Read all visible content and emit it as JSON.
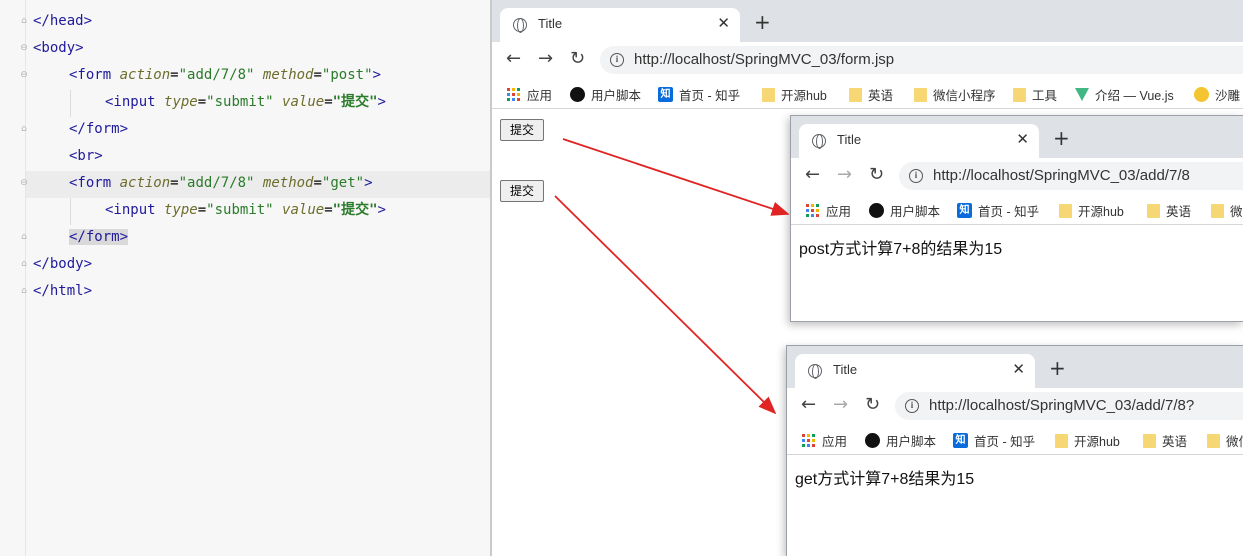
{
  "editor": {
    "lines": [
      {
        "text": "</head>"
      },
      {
        "text": "<body>"
      },
      {
        "form_open": "<form",
        "attr1": "action",
        "val1": "\"add/7/8\"",
        "attr2": "method",
        "val2": "\"post\"",
        "close": ">"
      },
      {
        "input_open": "<input",
        "attr1": "type",
        "val1": "\"submit\"",
        "attr2": "value",
        "val2": "\"提交\"",
        "close": ">"
      },
      {
        "text": "</form>"
      },
      {
        "text": "<br>"
      },
      {
        "form_open": "<form",
        "attr1": "action",
        "val1": "\"add/7/8\"",
        "attr2": "method",
        "val2": "\"get\"",
        "close": ">"
      },
      {
        "input_open": "<input",
        "attr1": "type",
        "val1": "\"submit\"",
        "attr2": "value",
        "val2": "\"提交\"",
        "close": ">"
      },
      {
        "text": "</form>"
      },
      {
        "text": "</body>"
      },
      {
        "text": "</html>"
      }
    ]
  },
  "browser_main": {
    "tab_title": "Title",
    "url": "http://localhost/SpringMVC_03/form.jsp",
    "bookmarks": [
      "应用",
      "用户脚本",
      "首页 - 知乎",
      "开源hub",
      "英语",
      "微信小程序",
      "工具",
      "介绍 — Vue.js",
      "沙雕"
    ],
    "buttons": [
      "提交",
      "提交"
    ]
  },
  "browser_post": {
    "tab_title": "Title",
    "url": "http://localhost/SpringMVC_03/add/7/8",
    "bookmarks": [
      "应用",
      "用户脚本",
      "首页 - 知乎",
      "开源hub",
      "英语",
      "微"
    ],
    "result": "post方式计算7+8的结果为15"
  },
  "browser_get": {
    "tab_title": "Title",
    "url": "http://localhost/SpringMVC_03/add/7/8?",
    "bookmarks": [
      "应用",
      "用户脚本",
      "首页 - 知乎",
      "开源hub",
      "英语",
      "微信"
    ],
    "result": "get方式计算7+8结果为15"
  },
  "colors": {
    "arrow": "#e02424",
    "tag": "#1f1a9b",
    "attr": "#6d6d2c",
    "string": "#2a7b2a"
  }
}
